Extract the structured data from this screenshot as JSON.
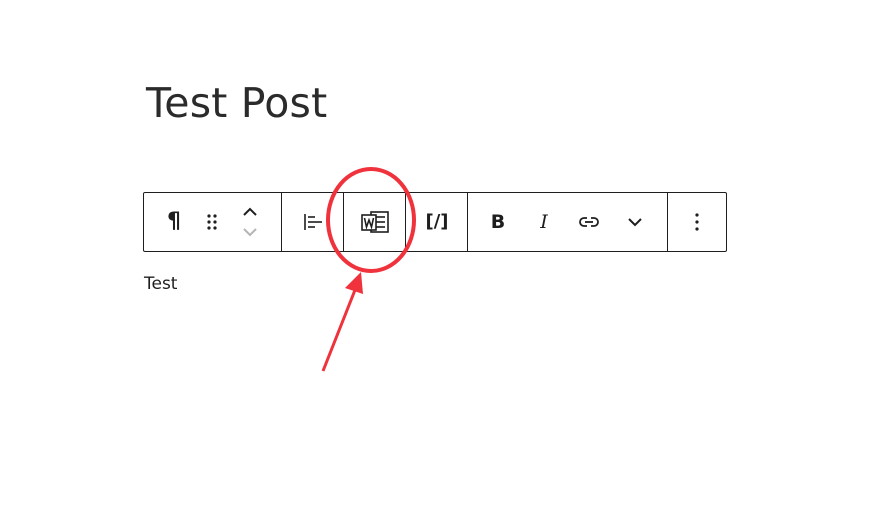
{
  "post": {
    "title": "Test Post",
    "paragraph": "Test"
  },
  "toolbar": {
    "paragraph_glyph": "¶",
    "shortcode_label": "[/]",
    "bold_label": "B",
    "italic_label": "I",
    "icons": [
      "paragraph-icon",
      "drag-handle-icon",
      "move-up-icon",
      "move-down-icon",
      "align-left-icon",
      "word-import-icon",
      "shortcode-icon",
      "bold-icon",
      "italic-icon",
      "link-icon",
      "chevron-down-icon",
      "more-options-icon"
    ]
  },
  "colors": {
    "annotation": "#f0323c",
    "text": "#1e1e1e",
    "title": "#2b2b2b"
  }
}
